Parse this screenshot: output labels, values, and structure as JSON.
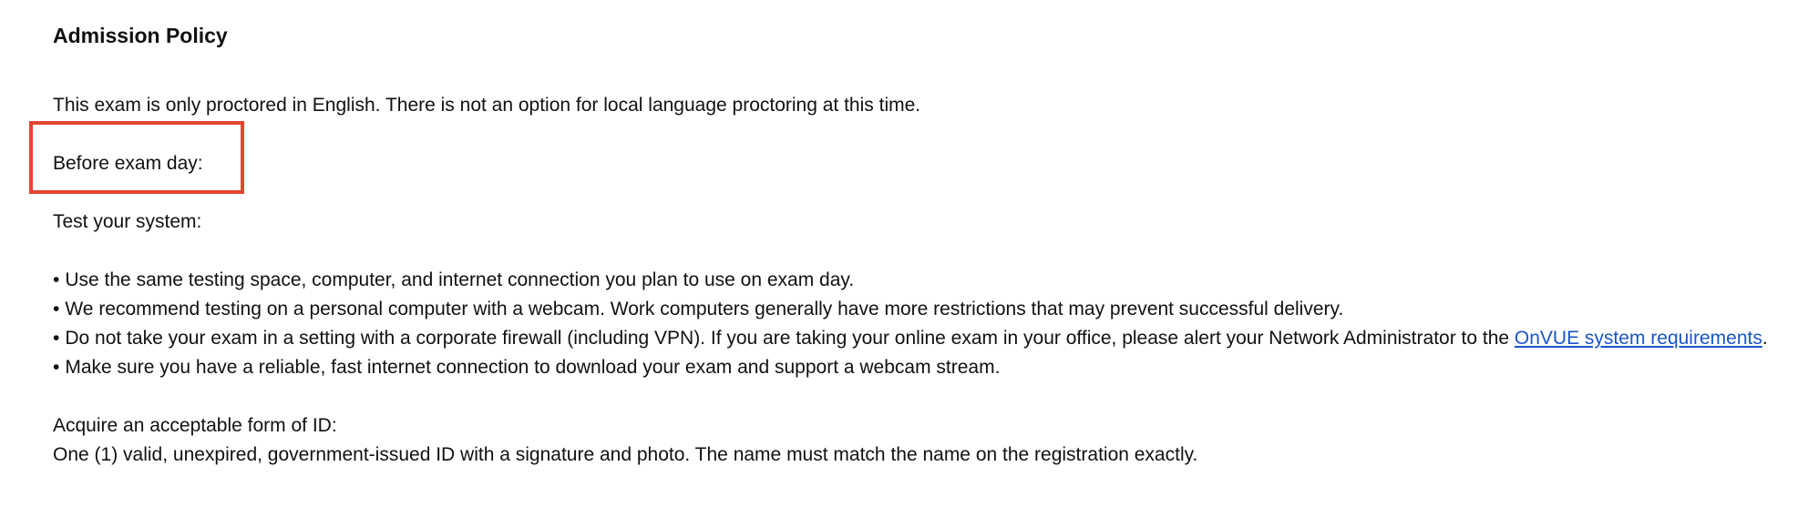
{
  "policy": {
    "heading": "Admission Policy",
    "intro": "This exam is only proctored in English. There is not an option for local language proctoring at this time.",
    "before_exam_label": "Before exam day:",
    "test_system_label": "Test your system:",
    "bullet_symbol": "•",
    "bullets": [
      "Use the same testing space, computer, and internet connection you plan to use on exam day.",
      "We recommend testing on a personal computer with a webcam. Work computers generally have more restrictions that may prevent successful delivery."
    ],
    "firewall_bullet": {
      "text": "Do not take your exam in a setting with a corporate firewall (including VPN). If you are taking your online exam in your office, please alert your Network Administrator to the ",
      "link_text": "OnVUE system requirements",
      "after": "."
    },
    "connection_bullet": "Make sure you have a reliable, fast internet connection to download your exam and support a webcam stream.",
    "id_label": "Acquire an acceptable form of ID:",
    "id_text": "One (1) valid, unexpired, government-issued ID with a signature and photo. The name must match the name on the registration exactly."
  },
  "colors": {
    "highlight_border": "#e2462f",
    "link": "#1a56c9",
    "text": "#111111"
  }
}
